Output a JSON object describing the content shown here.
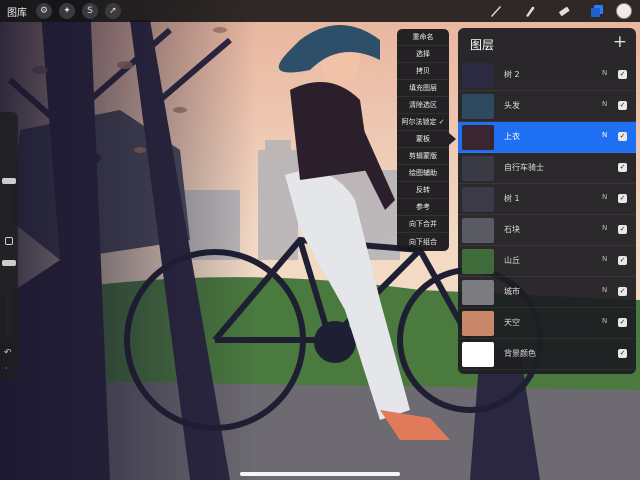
{
  "topbar": {
    "gallery_label": "图库",
    "left_tools": [
      {
        "icon": "wrench-icon",
        "glyph": "⚙"
      },
      {
        "icon": "magic-wand-icon",
        "glyph": "✦"
      },
      {
        "icon": "selection-icon",
        "glyph": "S"
      },
      {
        "icon": "transform-arrow-icon",
        "glyph": "➚"
      }
    ],
    "right_tools": [
      {
        "icon": "brush-icon"
      },
      {
        "icon": "smudge-icon"
      },
      {
        "icon": "eraser-icon"
      },
      {
        "icon": "layers-icon"
      }
    ],
    "current_color": "#f2ede4"
  },
  "context_menu": {
    "items": [
      "重命名",
      "选择",
      "拷贝",
      "填充图层",
      "清除选区",
      "阿尔法锁定 ✓",
      "蒙板",
      "剪辑蒙版",
      "绘图辅助",
      "反转",
      "参考",
      "向下合并",
      "向下组合"
    ]
  },
  "layers": {
    "title": "图层",
    "add_icon": "+",
    "items": [
      {
        "name": "树 2",
        "mode": "N",
        "checked": true,
        "active": false,
        "thumb": "#2b2a40"
      },
      {
        "name": "头发",
        "mode": "N",
        "checked": true,
        "active": false,
        "thumb": "#2f4a5e"
      },
      {
        "name": "上衣",
        "mode": "N",
        "checked": true,
        "active": true,
        "thumb": "#3a2630"
      },
      {
        "name": "自行车骑士",
        "mode": "",
        "checked": true,
        "active": false,
        "thumb": "#3a3a44"
      },
      {
        "name": "树 1",
        "mode": "N",
        "checked": true,
        "active": false,
        "thumb": "#3c3a46"
      },
      {
        "name": "石块",
        "mode": "N",
        "checked": true,
        "active": false,
        "thumb": "#5a5a62"
      },
      {
        "name": "山丘",
        "mode": "N",
        "checked": true,
        "active": false,
        "thumb": "#3f6b3a"
      },
      {
        "name": "城市",
        "mode": "N",
        "checked": true,
        "active": false,
        "thumb": "#7c7c80"
      },
      {
        "name": "天空",
        "mode": "N",
        "checked": true,
        "active": false,
        "thumb": "#c9876a"
      },
      {
        "name": "背景颜色",
        "mode": "",
        "checked": true,
        "active": false,
        "thumb": "#ffffff"
      }
    ],
    "check_glyph": "✓"
  },
  "sidebar": {
    "undo_glyph": "↶",
    "redo_glyph": "·"
  },
  "colors": {
    "accent": "#1f6ff2",
    "sky": "#f3d9c4",
    "tree_dark": "#2c2740",
    "grass": "#4a7a3e",
    "jeans": "#e4e6ea",
    "shirt": "#2a1f2a",
    "hair": "#2d4f6a",
    "bike": "#1f1f33",
    "shoe": "#e07a5a"
  }
}
